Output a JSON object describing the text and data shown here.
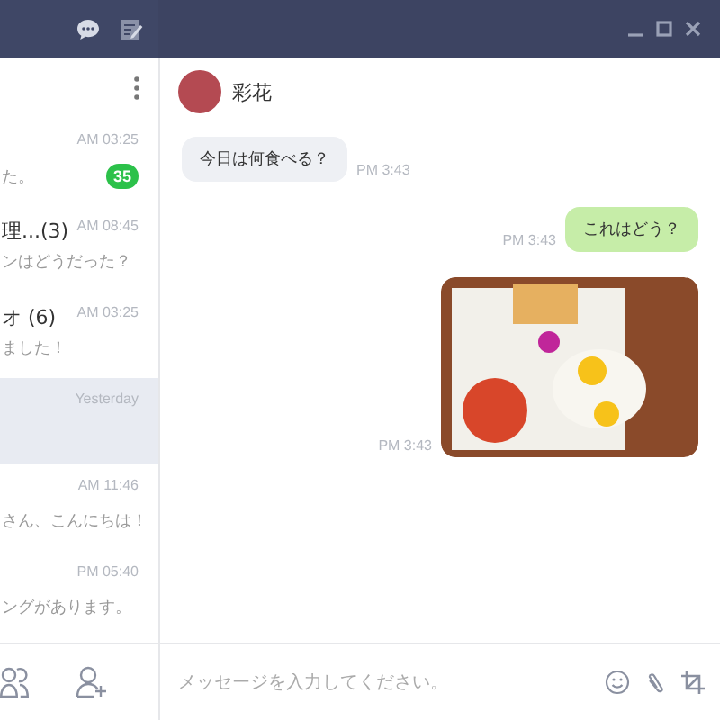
{
  "chat_list": [
    {
      "time": "AM 03:25",
      "preview": "た。",
      "unread": "35",
      "selected": false
    },
    {
      "name": "理...(3)",
      "time": "AM 08:45",
      "preview": "ンはどうだった？",
      "selected": false
    },
    {
      "name": "オ (6)",
      "time": "AM 03:25",
      "preview": "ました！",
      "selected": false
    },
    {
      "time": "Yesterday",
      "selected": true
    },
    {
      "time": "AM 11:46",
      "preview": "さん、こんにちは！",
      "selected": false
    },
    {
      "time": "PM 05:40",
      "preview": "ングがあります。",
      "selected": false
    }
  ],
  "contact": {
    "name": "彩花"
  },
  "messages": [
    {
      "kind": "text",
      "outgoing": false,
      "text": "今日は何食べる？",
      "time": "PM 3:43"
    },
    {
      "kind": "text",
      "outgoing": true,
      "text": "これはどう？",
      "time": "PM 3:43"
    },
    {
      "kind": "image",
      "outgoing": true,
      "time": "PM 3:43"
    }
  ],
  "composer": {
    "placeholder": "メッセージを入力してください。"
  }
}
